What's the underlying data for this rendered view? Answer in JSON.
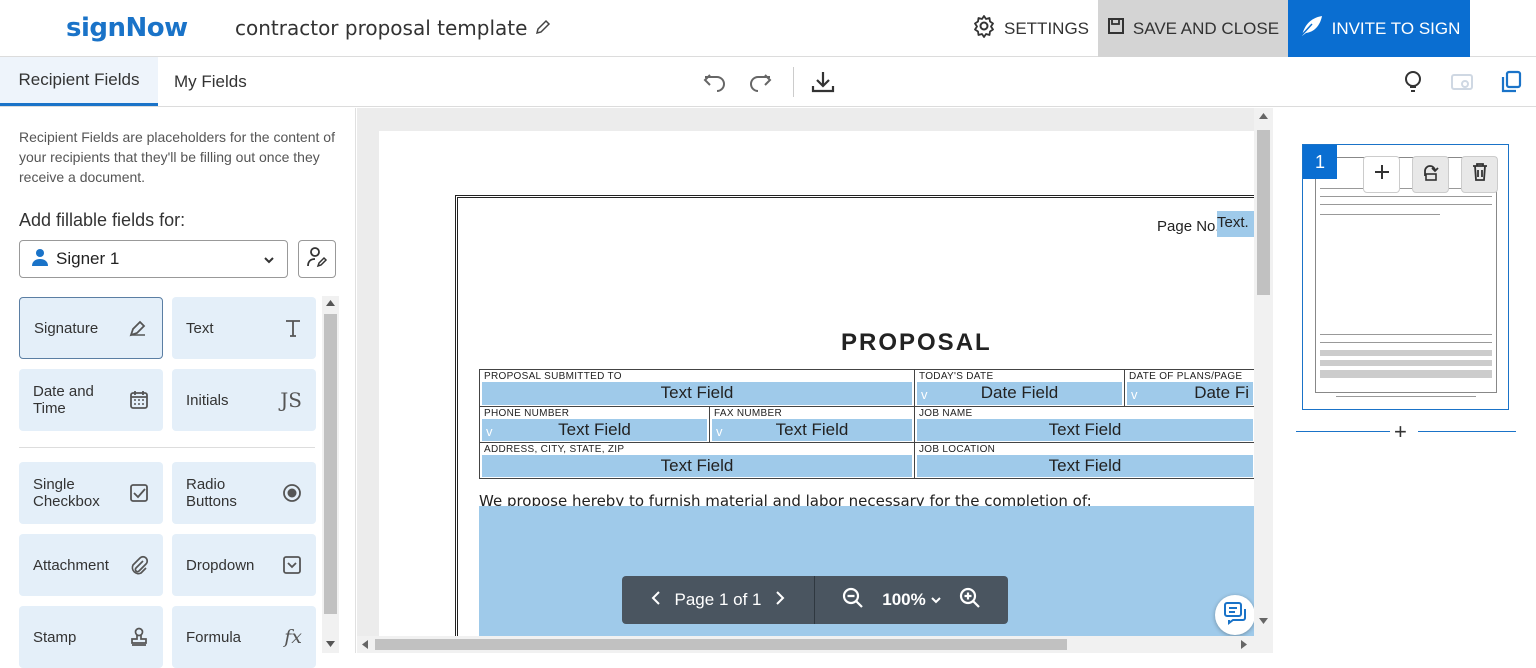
{
  "header": {
    "logo": "signNow",
    "doc_title": "contractor proposal template",
    "settings_label": "SETTINGS",
    "save_close_label": "SAVE AND CLOSE",
    "invite_label": "INVITE TO SIGN"
  },
  "tabs": [
    {
      "label": "Recipient Fields",
      "active": true
    },
    {
      "label": "My Fields",
      "active": false
    }
  ],
  "sidebar": {
    "intro": "Recipient Fields are placeholders for the content of your recipients that they'll be filling out once they receive a document.",
    "add_fields_label": "Add fillable fields for:",
    "signer": "Signer 1",
    "fields": [
      {
        "label": "Signature",
        "icon": "signature-pen-icon"
      },
      {
        "label": "Text",
        "icon": "text-t-icon"
      },
      {
        "label": "Date and Time",
        "icon": "calendar-icon"
      },
      {
        "label": "Initials",
        "icon": "initials-js-icon"
      },
      {
        "label": "Single Checkbox",
        "icon": "checkbox-icon"
      },
      {
        "label": "Radio Buttons",
        "icon": "radio-icon"
      },
      {
        "label": "Attachment",
        "icon": "paperclip-icon"
      },
      {
        "label": "Dropdown",
        "icon": "dropdown-icon"
      },
      {
        "label": "Stamp",
        "icon": "stamp-icon"
      },
      {
        "label": "Formula",
        "icon": "fx-icon"
      }
    ]
  },
  "document": {
    "page_no_label": "Page No.",
    "page_no_field": "Text.",
    "heading": "PROPOSAL",
    "labels": {
      "submitted_to": "PROPOSAL SUBMITTED TO",
      "todays_date": "TODAY'S DATE",
      "date_of_plans": "DATE OF PLANS/PAGE",
      "phone": "PHONE NUMBER",
      "fax": "FAX NUMBER",
      "job_name": "JOB NAME",
      "address": "ADDRESS, CITY, STATE, ZIP",
      "job_location": "JOB LOCATION"
    },
    "text_field": "Text Field",
    "date_field": "Date Field",
    "date_field_cut": "Date Fi",
    "v_marker": "v",
    "propose_text": "We propose hereby to furnish material and labor necessary for the completion of:"
  },
  "pager": {
    "page_label": "Page 1 of 1",
    "zoom": "100%"
  },
  "thumbnails": {
    "page_number": "1",
    "add_symbol": "+"
  },
  "colors": {
    "brand": "#1a73c8",
    "invite_bg": "#0a6ed1",
    "field_fill": "#9fcaea",
    "tile_bg": "#e4eff9"
  }
}
